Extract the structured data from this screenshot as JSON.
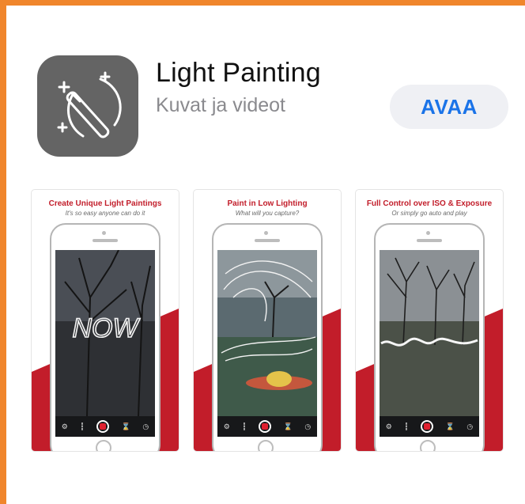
{
  "app": {
    "title": "Light Painting",
    "category": "Kuvat ja videot",
    "open_label": "AVAA",
    "icon": "magic-wand-icon"
  },
  "screenshots": [
    {
      "headline": "Create Unique Light Paintings",
      "subline": "It's so easy anyone can do it",
      "painted_word": "NOW"
    },
    {
      "headline": "Paint in Low Lighting",
      "subline": "What will you capture?"
    },
    {
      "headline": "Full Control over ISO & Exposure",
      "subline": "Or simply go auto and play"
    }
  ],
  "toolbar_icons": [
    "gear-icon",
    "flashlight-icon",
    "record-icon",
    "hourglass-icon",
    "timer-icon"
  ],
  "colors": {
    "frame": "#f0862c",
    "accent_red": "#c21d2a",
    "open_button_text": "#1a73e8",
    "open_button_bg": "#eff0f4",
    "icon_bg": "#646464"
  }
}
